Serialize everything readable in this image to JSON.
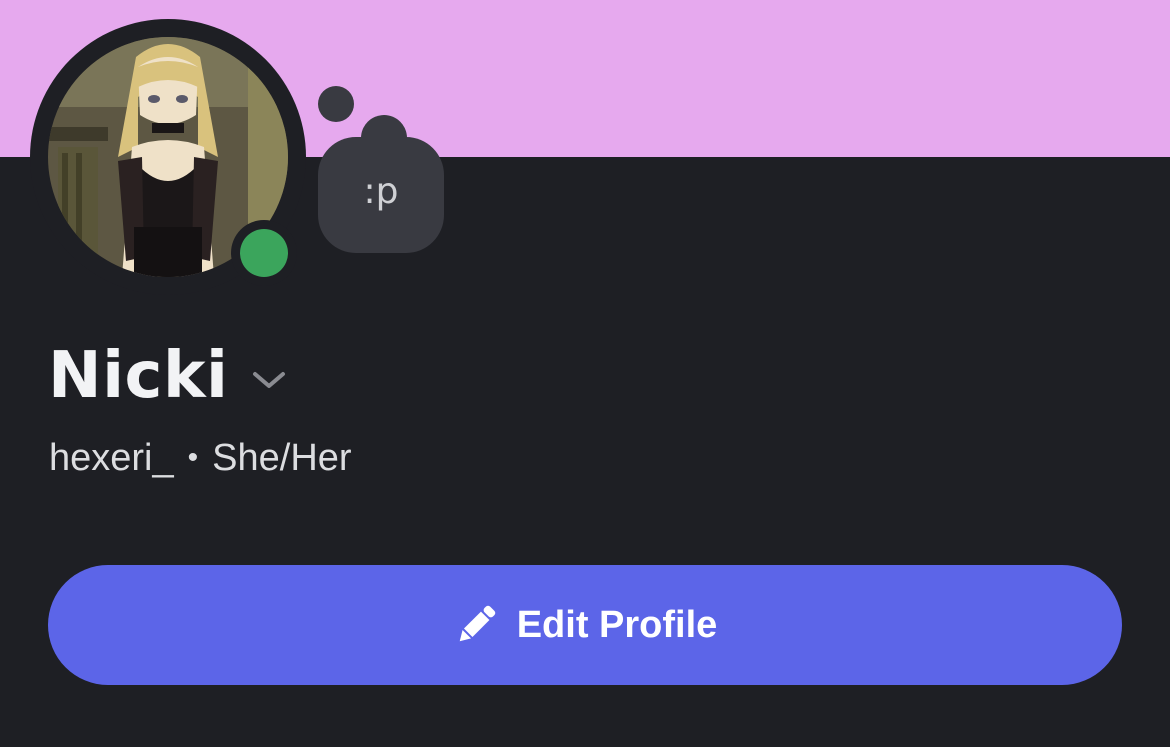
{
  "colors": {
    "banner": "#e6a9ee",
    "background": "#1e1f24",
    "status_online": "#3ba55c",
    "button": "#5c65e8"
  },
  "profile": {
    "display_name": "Nicki",
    "username": "hexeri_",
    "separator": "•",
    "pronouns": "She/Her",
    "custom_status": ":p",
    "status": "online"
  },
  "actions": {
    "edit_profile_label": "Edit Profile"
  },
  "icons": {
    "name_menu": "chevron-down-icon",
    "edit": "pencil-icon"
  }
}
